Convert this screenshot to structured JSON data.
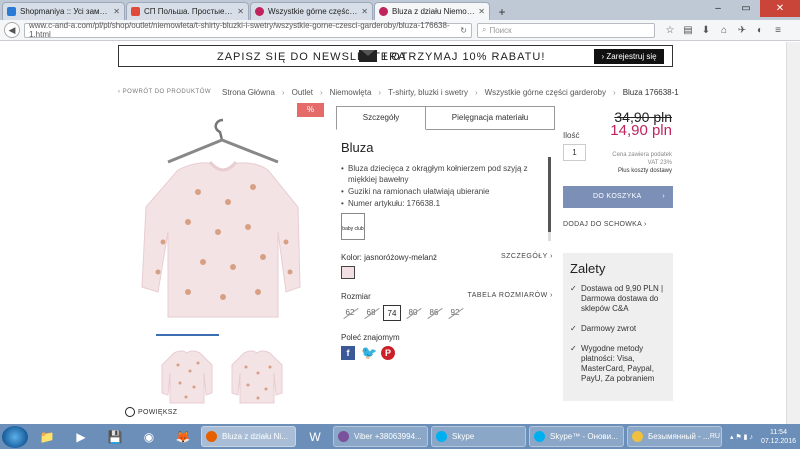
{
  "browser": {
    "tabs": [
      {
        "label": "Shopmaniya :: Усі замовле...",
        "color": "#2a7bd6"
      },
      {
        "label": "СП Польша. Простые усл...",
        "color": "#e04a3a"
      },
      {
        "label": "Wszystkie górne części gar...",
        "color": "#c0245c"
      },
      {
        "label": "Bluza z działu Niemowlęta ...",
        "color": "#c0245c"
      }
    ],
    "url": "www.c-and-a.com/pl/pl/shop/outlet/niemowleta/t-shirty-bluzki-i-swetry/wszystkie-gorne-czesci-garderoby/bluza-176638-1.html",
    "search_placeholder": "Поиск"
  },
  "newsletter": {
    "text_left": "ZAPISZ SIĘ DO NEWSLETTERA",
    "text_right": "I OTRZYMAJ 10% RABATU!",
    "button": "› Zarejestruj się"
  },
  "back_link": "‹ POWRÓT DO PRODUKTÓW",
  "breadcrumbs": [
    "Strona Główna",
    "Outlet",
    "Niemowlęta",
    "T-shirty, bluzki i swetry",
    "Wszystkie górne części garderoby",
    "Bluza 176638-1"
  ],
  "sale_badge": "%",
  "zoom_label": "POWIĘKSZ",
  "product": {
    "tab_details": "Szczegóły",
    "tab_care": "Pielęgnacja materiału",
    "name": "Bluza",
    "bullets": [
      "Bluza dziecięca z okrągłym kołnierzem pod szyją z miękkiej bawełny",
      "Guziki na ramionach ułatwiają ubieranie",
      "Numer artykułu: 176638.1"
    ],
    "badge": "baby club",
    "color_label": "Kolor: jasnoróżowy-melanż",
    "color_link": "SZCZEGÓŁY ›",
    "size_label": "Rozmiar",
    "size_link": "TABELA ROZMIARÓW ›",
    "sizes": [
      "62",
      "68",
      "74",
      "80",
      "86",
      "92"
    ],
    "selected_size": "74",
    "share_label": "Poleć znajomym"
  },
  "buy": {
    "qty_label": "Ilość",
    "qty": "1",
    "old_price": "34,90 pln",
    "new_price": "14,90 pln",
    "vat_line1": "Cena zawiera podatek",
    "vat_line2": "VAT 23%",
    "vat_line3": "Plus koszty dostawy",
    "cart_button": "DO KOSZYKA",
    "wishlist": "DODAJ DO SCHOWKA ›"
  },
  "advantages": {
    "title": "Zalety",
    "items": [
      "Dostawa od 9,90 PLN | Darmowa dostawa do sklepów C&A",
      "Darmowy zwrot",
      "Wygodne metody płatności: Visa, MasterCard, Paypal, PayU, Za pobraniem"
    ]
  },
  "taskbar": {
    "tasks": [
      "Bluza z działu Ni...",
      "Viber +38063994...",
      "Skype",
      "Skype™ - Онови...",
      "Безымянный - ..."
    ],
    "lang": "RU",
    "time": "11:54",
    "date": "07.12.2016"
  }
}
